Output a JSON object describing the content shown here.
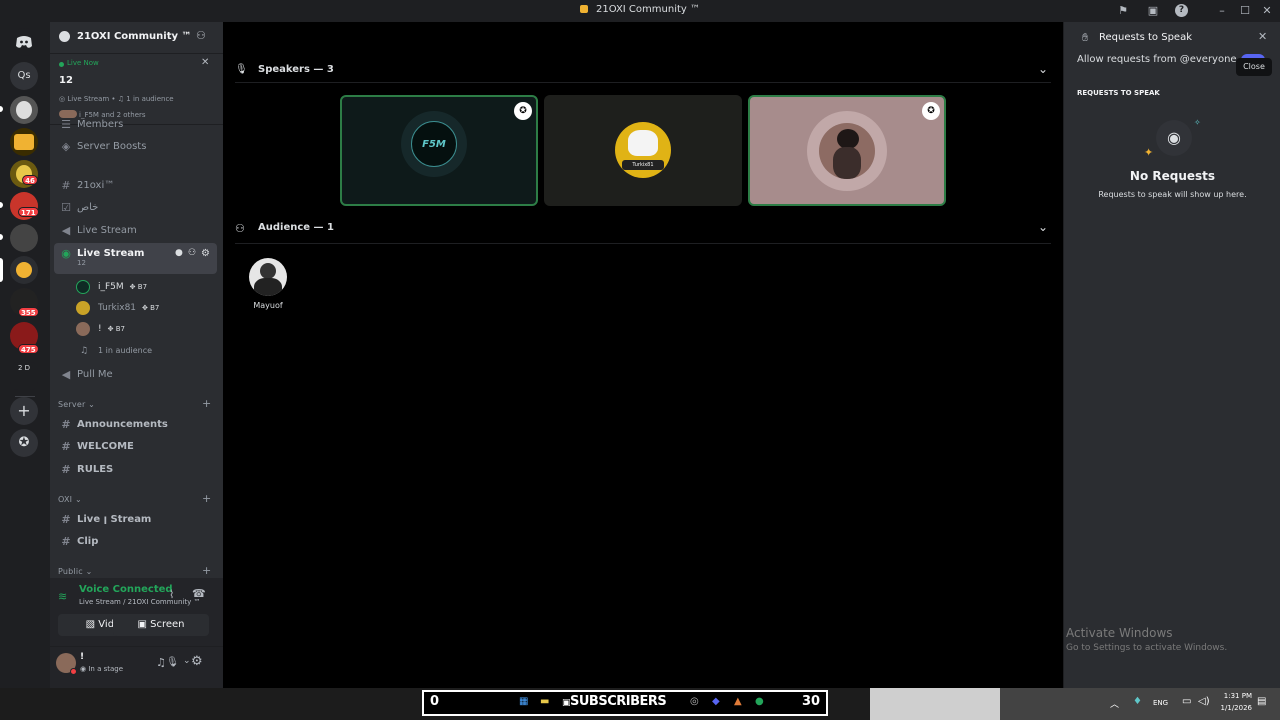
{
  "window": {
    "title": "21OXI Community ™"
  },
  "server": {
    "name": "21OXI Community ™"
  },
  "live_now": {
    "label": "Live Now",
    "count": "12",
    "channel": "Live Stream",
    "audience": "1 in audience",
    "users": "i_F5M and 2 others"
  },
  "guild_badges": [
    "46",
    "171",
    "355",
    "475",
    "2",
    "D"
  ],
  "guild_text": "Qs",
  "channels": {
    "members_cut": "Members",
    "server_boosts": "Server Boosts",
    "c1": "21oxi™",
    "c2": "خاص",
    "c3": "Live Stream",
    "active": {
      "name": "Live Stream",
      "count": "12"
    },
    "stage_users": [
      {
        "name": "i_F5M",
        "tag": "B7"
      },
      {
        "name": "Turkix81",
        "tag": "B7"
      },
      {
        "name": "!",
        "tag": "B7"
      }
    ],
    "audience": "1 in audience",
    "pull_me": "Pull Me",
    "cat_server": "Server",
    "announcements": "Announcements",
    "welcome": "WELCOME",
    "rules": "RULES",
    "cat_oxi": "OXI",
    "live_stream2": "Live ꞁ Stream",
    "clip": "Clip",
    "cat_public": "Public"
  },
  "voice": {
    "status": "Voice Connected",
    "location": "Live Stream / 21OXI Community ™",
    "video_label": "Video",
    "screen_label": "Screen",
    "user_name": "!",
    "user_status": "In a stage"
  },
  "stage": {
    "speakers_title": "Speakers — 3",
    "audience_title": "Audience — 1",
    "speaker_tiles": [
      {
        "label": "F5M"
      },
      {
        "label": "Turkix81"
      },
      {
        "label": ""
      }
    ],
    "audience_members": [
      {
        "name": "Mayuof"
      }
    ]
  },
  "requests_panel": {
    "title": "Requests to Speak",
    "allow_label": "Allow requests from @everyone",
    "close_tooltip": "Close",
    "section_label": "REQUESTS TO SPEAK",
    "empty_title": "No Requests",
    "empty_sub": "Requests to speak will show up here."
  },
  "watermark": {
    "line1": "Activate Windows",
    "line2": "Go to Settings to activate Windows."
  },
  "taskbar": {
    "counter_left": "0",
    "subscribers": "SUBSCRIBERS",
    "counter_right": "30",
    "lang": "ENG",
    "time": "1:31 PM",
    "date": "1/1/2026"
  },
  "colors": {
    "accent_green": "#23a55a",
    "discord_blurple": "#5865f2",
    "panel_bg": "#2b2d31",
    "rail_bg": "#1e1f22"
  }
}
